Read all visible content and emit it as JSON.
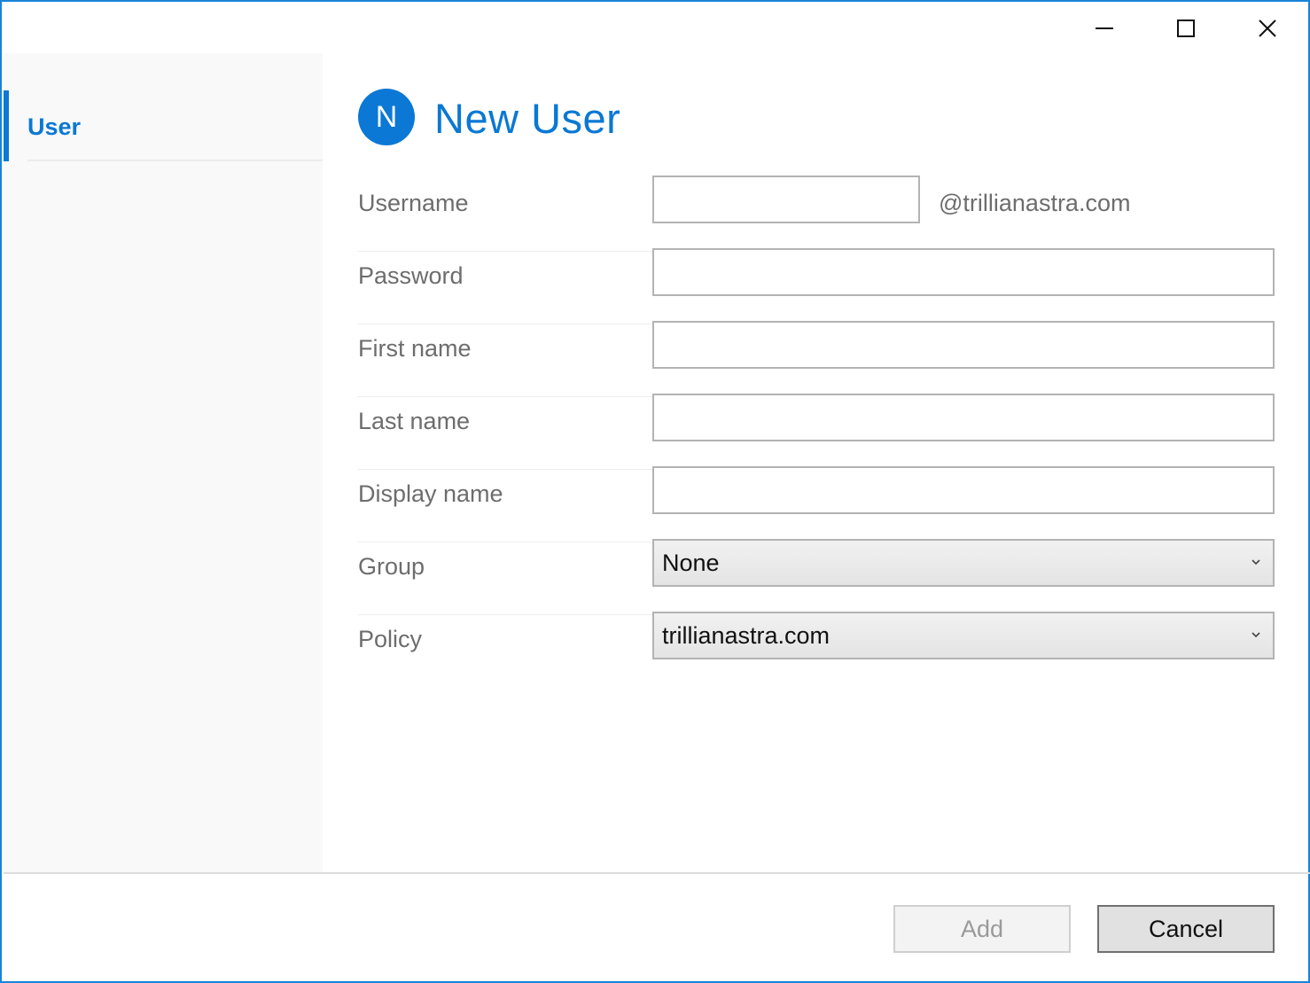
{
  "window": {
    "controls": {
      "minimize_icon": "minimize-icon",
      "maximize_icon": "maximize-icon",
      "close_icon": "close-icon"
    }
  },
  "sidebar": {
    "items": [
      {
        "label": "User",
        "selected": true
      }
    ]
  },
  "header": {
    "avatar_initial": "N",
    "title": "New User"
  },
  "form": {
    "username": {
      "label": "Username",
      "value": "",
      "suffix": "@trillianastra.com"
    },
    "password": {
      "label": "Password",
      "value": ""
    },
    "first_name": {
      "label": "First name",
      "value": ""
    },
    "last_name": {
      "label": "Last name",
      "value": ""
    },
    "display_name": {
      "label": "Display name",
      "value": ""
    },
    "group": {
      "label": "Group",
      "selected": "None"
    },
    "policy": {
      "label": "Policy",
      "selected": "trillianastra.com"
    }
  },
  "footer": {
    "add_label": "Add",
    "add_enabled": false,
    "cancel_label": "Cancel"
  },
  "colors": {
    "accent": "#0a78d4",
    "window_border": "#1883d7",
    "label_text": "#6d6d6d",
    "disabled_text": "#9a9a9a"
  }
}
